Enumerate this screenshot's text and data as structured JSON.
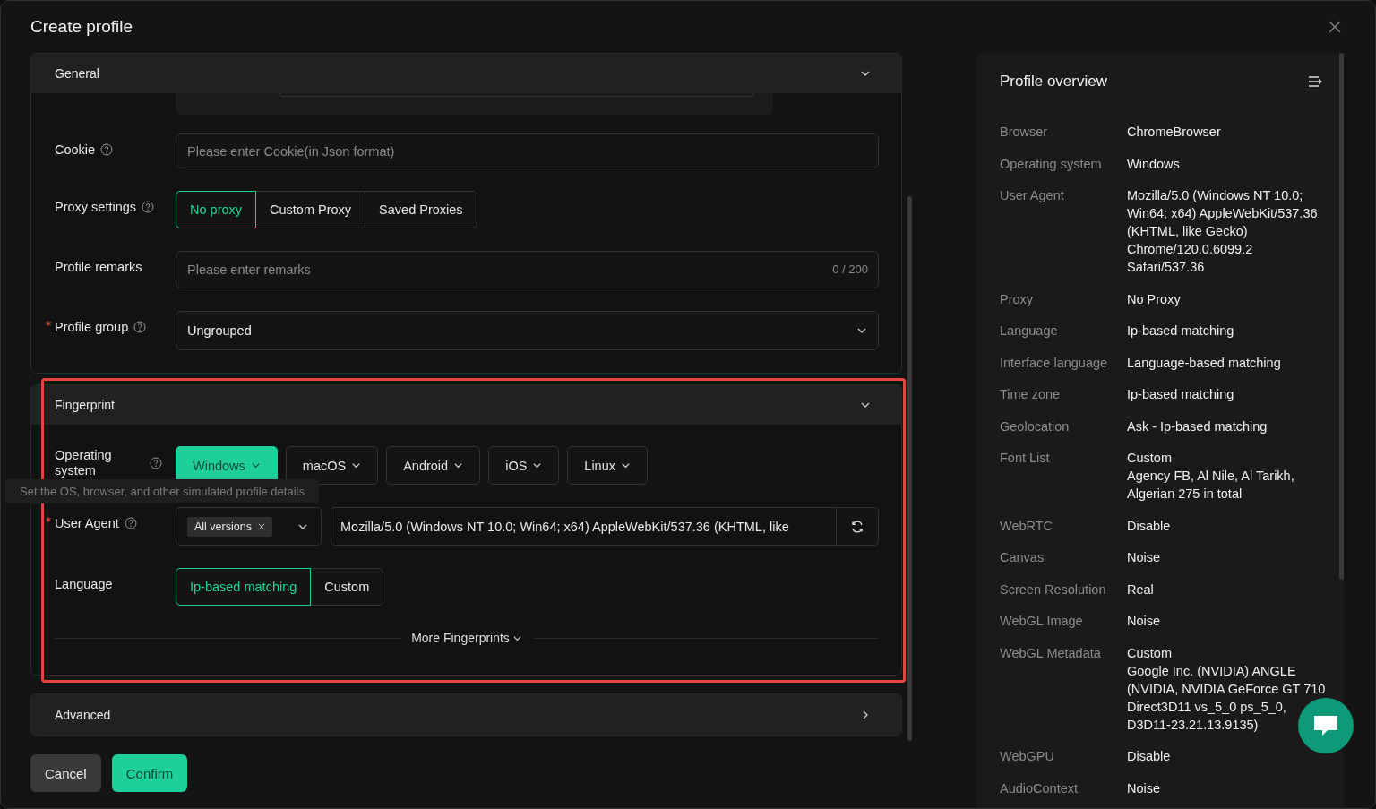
{
  "dialog": {
    "title": "Create profile"
  },
  "sections": [
    {
      "kind": "general",
      "title": "General",
      "expanded": true,
      "cookie": {
        "label": "Cookie",
        "placeholder": "Please enter Cookie(in Json format)"
      },
      "proxy": {
        "label": "Proxy settings",
        "options": [
          {
            "label": "No proxy",
            "selected": true
          },
          {
            "label": "Custom Proxy",
            "selected": false
          },
          {
            "label": "Saved Proxies",
            "selected": false
          }
        ]
      },
      "remarks": {
        "label": "Profile remarks",
        "placeholder": "Please enter remarks",
        "counter": "0 / 200"
      },
      "group": {
        "label": "Profile group",
        "required": true,
        "value": "Ungrouped"
      }
    },
    {
      "kind": "fingerprint",
      "title": "Fingerprint",
      "expanded": true,
      "highlighted": true,
      "os": {
        "label": "Operating system",
        "tooltip": "Set the OS, browser, and other simulated profile details",
        "options": [
          {
            "label": "Windows",
            "selected": true
          },
          {
            "label": "macOS",
            "selected": false
          },
          {
            "label": "Android",
            "selected": false
          },
          {
            "label": "iOS",
            "selected": false
          },
          {
            "label": "Linux",
            "selected": false
          }
        ]
      },
      "user_agent": {
        "label": "User Agent",
        "required": true,
        "version_tag": "All versions",
        "value": "Mozilla/5.0 (Windows NT 10.0; Win64; x64) AppleWebKit/537.36 (KHTML, like"
      },
      "language": {
        "label": "Language",
        "options": [
          {
            "label": "Ip-based matching",
            "selected": true
          },
          {
            "label": "Custom",
            "selected": false
          }
        ]
      },
      "more": "More Fingerprints"
    },
    {
      "kind": "advanced",
      "title": "Advanced",
      "expanded": false
    }
  ],
  "buttons": [
    {
      "label": "Cancel",
      "kind": "secondary"
    },
    {
      "label": "Confirm",
      "kind": "primary"
    }
  ],
  "overview": {
    "title": "Profile overview",
    "rows": [
      {
        "label": "Browser",
        "value": [
          "ChromeBrowser"
        ]
      },
      {
        "label": "Operating system",
        "value": [
          "Windows"
        ]
      },
      {
        "label": "User Agent",
        "value": [
          "Mozilla/5.0 (Windows NT 10.0;",
          "Win64; x64) AppleWebKit/537.36",
          "(KHTML, like Gecko)",
          "Chrome/120.0.6099.2",
          "Safari/537.36"
        ]
      },
      {
        "label": "Proxy",
        "value": [
          "No Proxy"
        ]
      },
      {
        "label": "Language",
        "value": [
          "Ip-based matching"
        ]
      },
      {
        "label": "Interface language",
        "value": [
          "Language-based matching"
        ]
      },
      {
        "label": "Time zone",
        "value": [
          "Ip-based matching"
        ]
      },
      {
        "label": "Geolocation",
        "value": [
          "Ask - Ip-based matching"
        ]
      },
      {
        "label": "Font List",
        "value": [
          "Custom",
          "Agency FB, Al Nile, Al Tarikh,",
          "Algerian 275 in total"
        ]
      },
      {
        "label": "WebRTC",
        "value": [
          "Disable"
        ]
      },
      {
        "label": "Canvas",
        "value": [
          "Noise"
        ]
      },
      {
        "label": "Screen Resolution",
        "value": [
          "Real"
        ]
      },
      {
        "label": "WebGL Image",
        "value": [
          "Noise"
        ]
      },
      {
        "label": "WebGL Metadata",
        "value": [
          "Custom",
          "Google Inc. (NVIDIA) ANGLE",
          "(NVIDIA, NVIDIA GeForce GT 710",
          "Direct3D11 vs_5_0 ps_5_0,",
          "D3D11-23.21.13.9135)"
        ]
      },
      {
        "label": "WebGPU",
        "value": [
          "Disable"
        ]
      },
      {
        "label": "AudioContext",
        "value": [
          "Noise"
        ]
      }
    ]
  }
}
